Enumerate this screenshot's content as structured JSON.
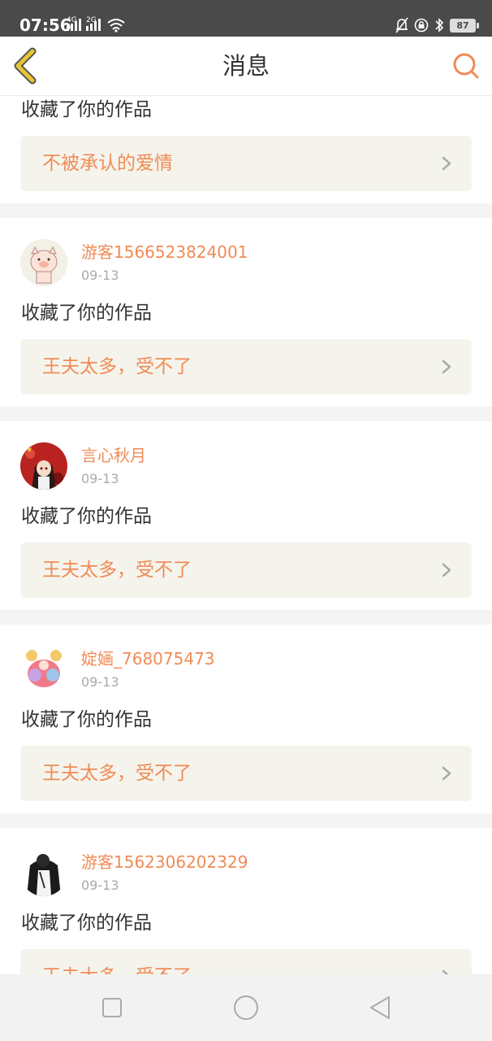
{
  "status_bar": {
    "time": "07:56",
    "net1": "4G",
    "net2": "2G",
    "battery": "87",
    "icons": [
      "signal-icon",
      "wifi-icon",
      "bell-off-icon",
      "lock-rotation-icon",
      "bluetooth-icon",
      "battery-icon"
    ]
  },
  "header": {
    "title": "消息",
    "back_icon": "back-chevron-icon",
    "search_icon": "search-icon",
    "accent_color": "#f08b56",
    "back_color": "#e8c533"
  },
  "messages": [
    {
      "action": "收藏了你的作品",
      "work": "不被承认的爱情"
    },
    {
      "username": "游客1566523824001",
      "date": "09-13",
      "action": "收藏了你的作品",
      "work": "王夫太多，受不了"
    },
    {
      "username": "言心秋月",
      "date": "09-13",
      "action": "收藏了你的作品",
      "work": "王夫太多，受不了"
    },
    {
      "username": "婝婳_768075473",
      "date": "09-13",
      "action": "收藏了你的作品",
      "work": "王夫太多，受不了"
    },
    {
      "username": "游客1562306202329",
      "date": "09-13",
      "action": "收藏了你的作品",
      "work": "王夫太多，受不了"
    }
  ],
  "navbar": {
    "icons": [
      "recents-square-icon",
      "home-circle-icon",
      "back-triangle-icon"
    ]
  }
}
